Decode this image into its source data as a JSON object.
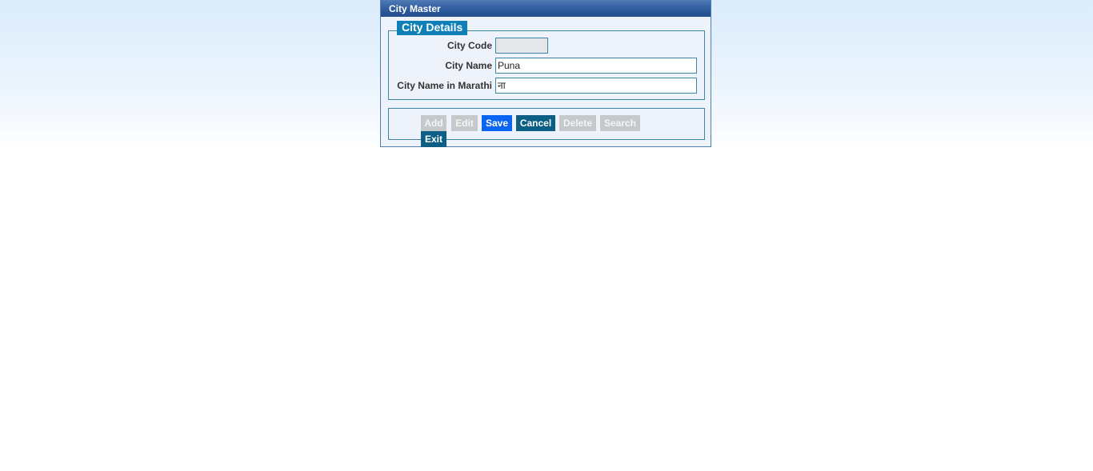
{
  "panel": {
    "title": "City Master"
  },
  "city_details": {
    "legend": "City Details",
    "fields": {
      "city_code": {
        "label": "City Code",
        "value": ""
      },
      "city_name": {
        "label": "City Name",
        "value": "Puna"
      },
      "city_name_marathi": {
        "label": "City Name in Marathi",
        "value": "ना"
      }
    }
  },
  "buttons": {
    "add": "Add",
    "edit": "Edit",
    "save": "Save",
    "cancel": "Cancel",
    "delete": "Delete",
    "search": "Search",
    "exit": "Exit"
  },
  "colors": {
    "header": "#2f5b9c",
    "legend": "#0f7fb8",
    "save": "#0a65f0",
    "cancel_exit": "#0c5e84",
    "disabled": "#c6c9cc",
    "border": "#3c87a8"
  }
}
